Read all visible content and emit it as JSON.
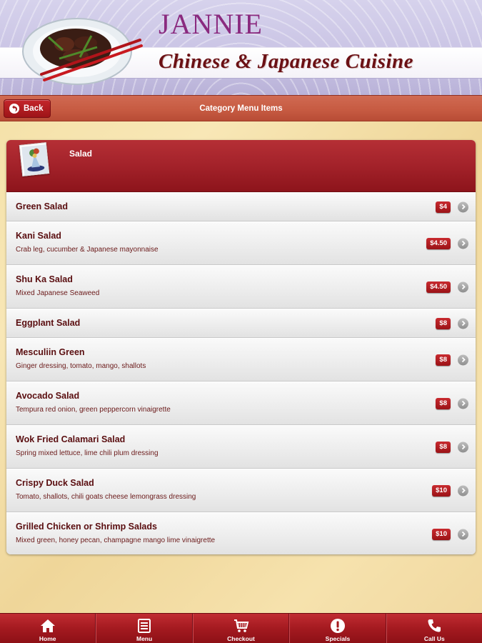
{
  "header": {
    "brand_name": "JANNIE",
    "tagline": "Chinese & Japanese Cuisine",
    "logo_icon": "plate-with-food-and-chopsticks"
  },
  "titlebar": {
    "back_label": "Back",
    "title": "Category Menu Items"
  },
  "category": {
    "title": "Salad",
    "image_icon": "salad-photo-thumbnail"
  },
  "items": [
    {
      "name": "Green Salad",
      "desc": "",
      "price": "$4"
    },
    {
      "name": "Kani Salad",
      "desc": "Crab leg, cucumber & Japanese mayonnaise",
      "price": "$4.50"
    },
    {
      "name": "Shu Ka Salad",
      "desc": "Mixed Japanese Seaweed",
      "price": "$4.50"
    },
    {
      "name": "Eggplant Salad",
      "desc": "",
      "price": "$8"
    },
    {
      "name": "Mesculiin Green",
      "desc": "Ginger dressing, tomato, mango, shallots",
      "price": "$8"
    },
    {
      "name": "Avocado Salad",
      "desc": "Tempura red onion, green peppercorn vinaigrette",
      "price": "$8"
    },
    {
      "name": "Wok Fried Calamari Salad",
      "desc": "Spring mixed lettuce, lime chili plum dressing",
      "price": "$8"
    },
    {
      "name": "Crispy Duck Salad",
      "desc": "Tomato, shallots, chili goats cheese lemongrass dressing",
      "price": "$10"
    },
    {
      "name": "Grilled Chicken or Shrimp Salads",
      "desc": "Mixed green, honey pecan, champagne mango lime vinaigrette",
      "price": "$10"
    }
  ],
  "tabs": [
    {
      "label": "Home",
      "icon": "home-icon"
    },
    {
      "label": "Menu",
      "icon": "menu-list-icon"
    },
    {
      "label": "Checkout",
      "icon": "cart-icon"
    },
    {
      "label": "Specials",
      "icon": "exclamation-icon"
    },
    {
      "label": "Call Us",
      "icon": "phone-icon"
    }
  ],
  "colors": {
    "brand_purple": "#8a2a7f",
    "tagline_maroon": "#6b1014",
    "titlebar_red": "#c65a41",
    "accent_red": "#a3222a",
    "item_text": "#5a0e10",
    "background_gold": "#f3dfa3"
  }
}
